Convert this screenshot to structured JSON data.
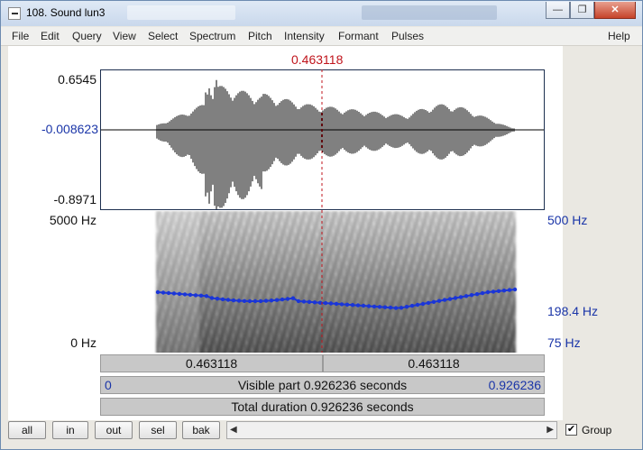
{
  "window": {
    "title": "108. Sound lun3",
    "min": "—",
    "max": "❐",
    "close": "✕"
  },
  "menu": [
    {
      "label": "File"
    },
    {
      "label": "Edit"
    },
    {
      "label": "Query"
    },
    {
      "label": "View"
    },
    {
      "label": "Select"
    },
    {
      "label": "Spectrum"
    },
    {
      "label": "Pitch"
    },
    {
      "label": "Intensity"
    },
    {
      "label": "Formant"
    },
    {
      "label": "Pulses"
    },
    {
      "label": "Help"
    }
  ],
  "cursor": {
    "time": "0.463118"
  },
  "waveform": {
    "top": "0.6545",
    "zero": "-0.008623",
    "bottom": "-0.8971"
  },
  "spectrogram": {
    "freq_top": "5000 Hz",
    "freq_bottom": "0 Hz"
  },
  "pitch": {
    "top": "500 Hz",
    "mark": "198.4 Hz",
    "bottom": "75 Hz"
  },
  "time_bars": {
    "left": "0.463118",
    "right": "0.463118",
    "visible_start": "0",
    "visible_text": "Visible part 0.926236 seconds",
    "visible_end": "0.926236",
    "total_text": "Total duration 0.926236 seconds"
  },
  "buttons": {
    "all": "all",
    "in": "in",
    "out": "out",
    "sel": "sel",
    "bak": "bak"
  },
  "group": {
    "label": "Group",
    "checked": "✔"
  },
  "colors": {
    "cursor": "#c0141c",
    "pitch": "#1a35d8",
    "axis_blue": "#1a35a8"
  }
}
